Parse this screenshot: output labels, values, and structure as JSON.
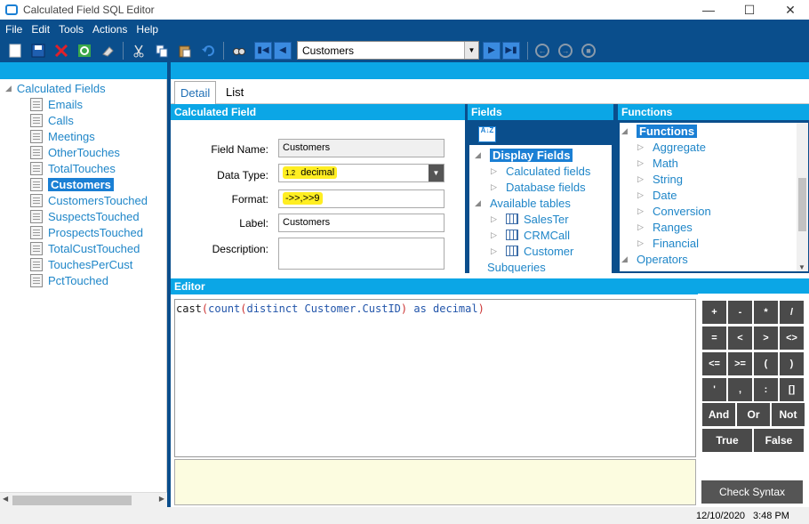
{
  "window": {
    "title": "Calculated Field SQL Editor"
  },
  "menu": [
    "File",
    "Edit",
    "Tools",
    "Actions",
    "Help"
  ],
  "toolbar": {
    "table_combo": "Customers",
    "icons": [
      "new-icon",
      "save-icon",
      "delete-icon",
      "refresh-icon",
      "eraser-icon",
      "cut-icon",
      "copy-icon",
      "paste-icon",
      "undo-icon",
      "find-icon",
      "first-record-icon",
      "prev-record-icon",
      "next-record-icon",
      "last-record-icon",
      "back-icon",
      "forward-icon",
      "stop-icon"
    ]
  },
  "left_tree": {
    "root": "Calculated Fields",
    "items": [
      "Emails",
      "Calls",
      "Meetings",
      "OtherTouches",
      "TotalTouches",
      "Customers",
      "CustomersTouched",
      "SuspectsTouched",
      "ProspectsTouched",
      "TotalCustTouched",
      "TouchesPerCust",
      "PctTouched"
    ],
    "selected": "Customers"
  },
  "tabs": [
    "Detail",
    "List"
  ],
  "calc_field": {
    "header": "Calculated Field",
    "field_name_label": "Field Name:",
    "field_name": "Customers",
    "data_type_label": "Data Type:",
    "data_type_icon": "1.2",
    "data_type": "decimal",
    "format_label": "Format:",
    "format": "->>,>>9",
    "label_label": "Label:",
    "label": "Customers",
    "description_label": "Description:",
    "description": ""
  },
  "fields_panel": {
    "header": "Fields",
    "sort_icon": "A↓Z",
    "display_fields": "Display Fields",
    "calculated_fields": "Calculated fields",
    "database_fields": "Database fields",
    "available_tables": "Available tables",
    "tables": [
      "SalesTer",
      "CRMCall",
      "Customer"
    ],
    "subqueries": "Subqueries"
  },
  "functions_panel": {
    "header": "Functions",
    "root": "Functions",
    "items": [
      "Aggregate",
      "Math",
      "String",
      "Date",
      "Conversion",
      "Ranges",
      "Financial"
    ],
    "operators": "Operators"
  },
  "editor": {
    "header": "Editor",
    "code": {
      "t1": "cast",
      "t2": "(",
      "t3": "count",
      "t4": "(",
      "t5": "distinct Customer.CustID",
      "t6": ")",
      "t7": " as decimal",
      "t8": ")"
    }
  },
  "operators": {
    "row1": [
      "+",
      "-",
      "*",
      "/"
    ],
    "row2": [
      "=",
      "<",
      ">",
      "<>"
    ],
    "row3": [
      "<=",
      ">=",
      "(",
      ")"
    ],
    "row4": [
      "'",
      ",",
      ":",
      "[]"
    ],
    "row5": [
      "And",
      "Or",
      "Not"
    ],
    "row6": [
      "True",
      "False"
    ],
    "check_syntax": "Check Syntax"
  },
  "status": {
    "date": "12/10/2020",
    "time": "3:48 PM"
  },
  "colors": {
    "accent": "#0ba6e6",
    "dark": "#0a4e8c",
    "selection": "#1a7fd4",
    "highlight": "#ffee22"
  }
}
